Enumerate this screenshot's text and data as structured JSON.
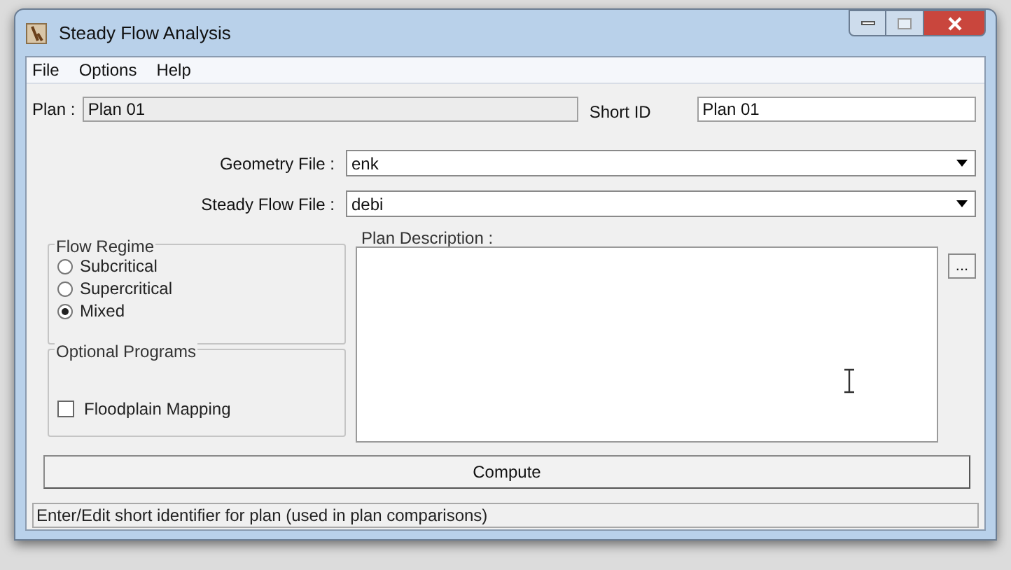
{
  "window": {
    "title": "Steady Flow Analysis"
  },
  "menu": [
    {
      "label": "File"
    },
    {
      "label": "Options"
    },
    {
      "label": "Help"
    }
  ],
  "plan": {
    "label": "Plan :",
    "value": "Plan 01"
  },
  "short_id": {
    "label": "Short ID",
    "value": "Plan 01"
  },
  "files": [
    {
      "label": "Geometry File :",
      "value": "enk"
    },
    {
      "label": "Steady Flow File :",
      "value": "debi"
    }
  ],
  "plan_description": {
    "label": "Plan Description :",
    "browse_button": "..."
  },
  "flow_regime": {
    "title": "Flow Regime",
    "options": [
      {
        "label": "Subcritical",
        "selected": false
      },
      {
        "label": "Supercritical",
        "selected": false
      },
      {
        "label": "Mixed",
        "selected": true
      }
    ]
  },
  "optional_programs": {
    "title": "Optional Programs",
    "options": [
      {
        "label": "Floodplain Mapping",
        "checked": false
      }
    ]
  },
  "compute_button": "Compute",
  "status_bar": "Enter/Edit short identifier for plan (used in plan comparisons)"
}
